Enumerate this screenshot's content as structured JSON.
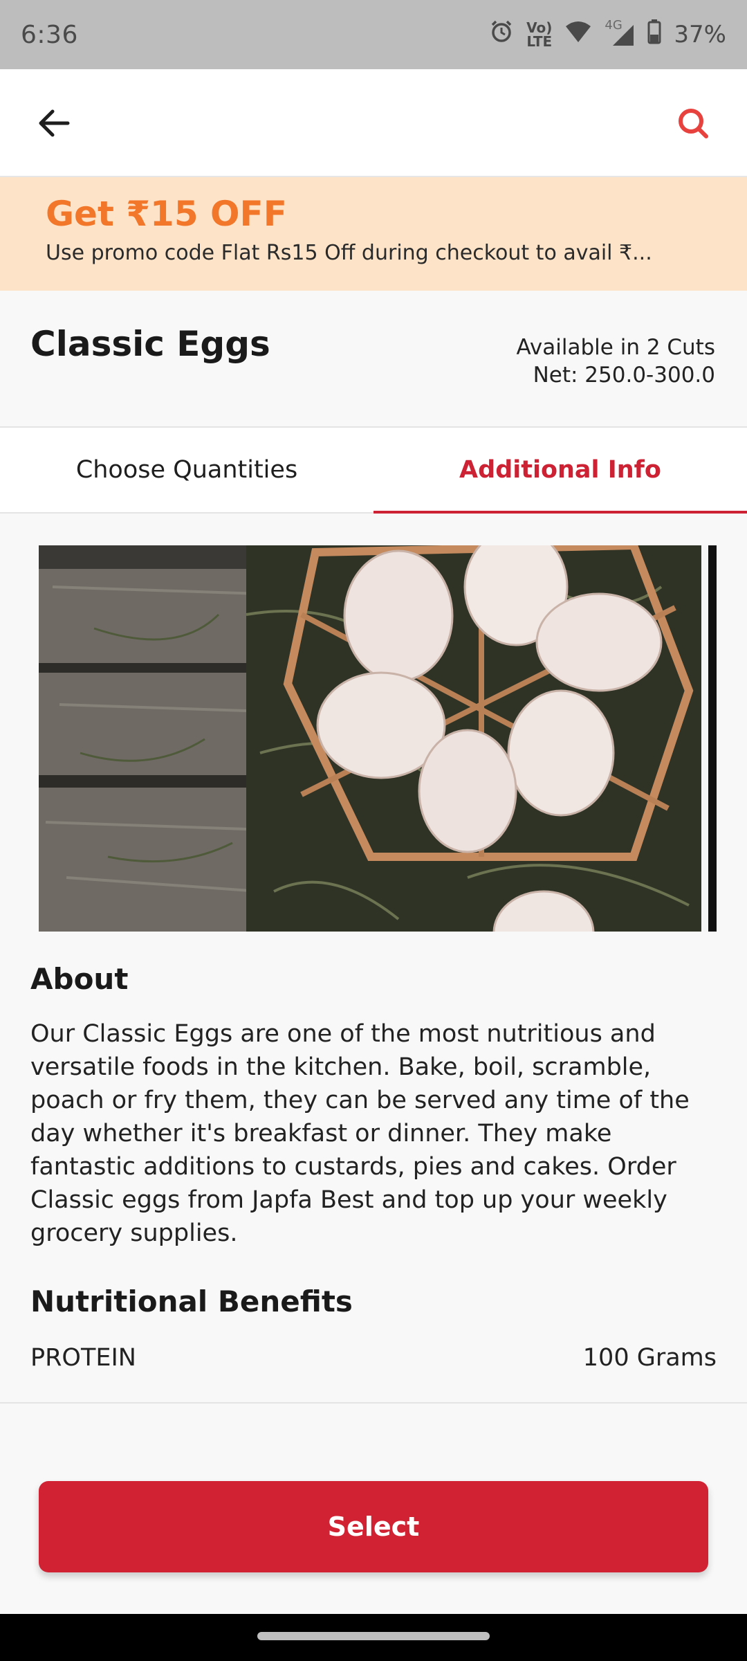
{
  "status_bar": {
    "time": "6:36",
    "volte_label_1": "Vo)",
    "volte_label_2": "LTE",
    "network_label": "4G",
    "battery": "37%"
  },
  "app_bar": {
    "back_icon": "arrow-left-icon",
    "search_icon": "search-icon",
    "accent_color": "#e8423f"
  },
  "promo": {
    "title": "Get ₹15 OFF",
    "text": "Use promo code Flat Rs15 Off  during checkout to avail ₹...",
    "title_color": "#f2772b",
    "background": "#fde3c8"
  },
  "product": {
    "title": "Classic Eggs",
    "availability": "Available in 2 Cuts",
    "net": "Net: 250.0-300.0"
  },
  "tabs": [
    {
      "label": "Choose Quantities",
      "active": false
    },
    {
      "label": "Additional Info",
      "active": true
    }
  ],
  "about": {
    "heading": "About",
    "text": "Our Classic Eggs are one of the most nutritious and versatile foods in the kitchen. Bake, boil, scramble, poach or fry them, they can be served any time of the day whether it's breakfast or dinner. They make fantastic additions to custards, pies and cakes. Order Classic eggs from Japfa Best and top up your weekly grocery supplies."
  },
  "nutrition": {
    "heading": "Nutritional Benefits",
    "items": [
      {
        "name": "PROTEIN",
        "value": "100 Grams"
      }
    ]
  },
  "select_button": {
    "label": "Select",
    "color": "#d12233"
  }
}
